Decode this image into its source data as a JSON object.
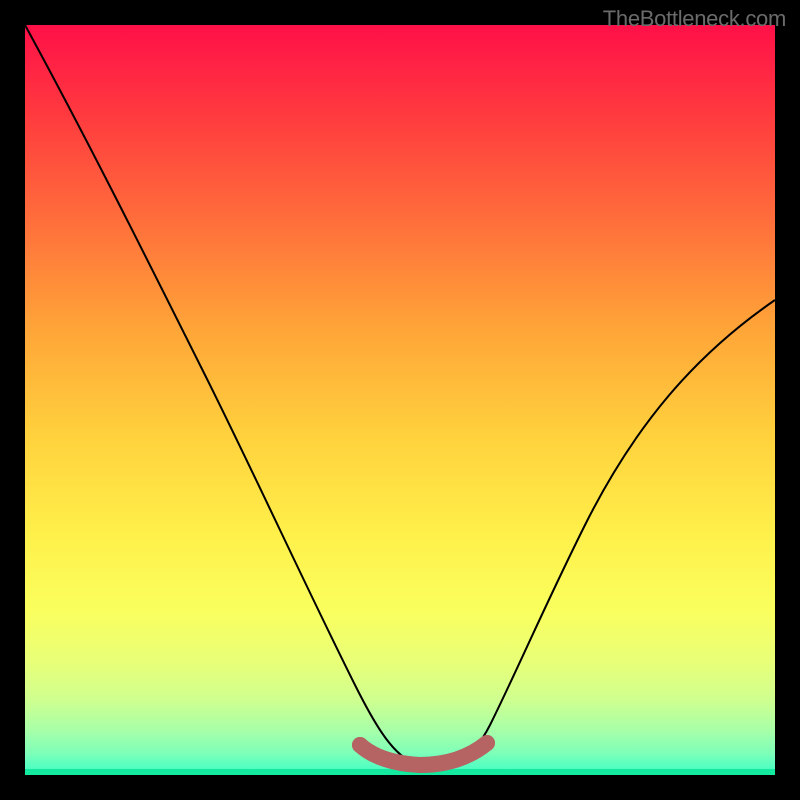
{
  "watermark": "TheBottleneck.com",
  "colors": {
    "frame": "#000000",
    "gradient_top": "#ff1048",
    "gradient_mid": "#ffd23d",
    "gradient_bottom": "#13e99f",
    "curve": "#000000",
    "band": "#b56363"
  },
  "chart_data": {
    "type": "line",
    "title": "",
    "xlabel": "",
    "ylabel": "",
    "xlim": [
      0,
      100
    ],
    "ylim": [
      0,
      100
    ],
    "grid": false,
    "legend": false,
    "annotations": [
      "TheBottleneck.com"
    ],
    "series": [
      {
        "name": "bottleneck-curve",
        "x": [
          0,
          5,
          10,
          15,
          20,
          25,
          30,
          35,
          40,
          42,
          45,
          48,
          51,
          54,
          57,
          60,
          62,
          65,
          70,
          75,
          80,
          85,
          90,
          95,
          100
        ],
        "y": [
          100,
          92,
          83,
          73,
          62,
          51,
          40,
          30,
          20,
          14,
          8,
          4,
          2,
          1,
          1,
          2,
          4,
          8,
          15,
          24,
          33,
          42,
          50,
          57,
          63
        ]
      },
      {
        "name": "zero-bottleneck-band",
        "x": [
          45,
          48,
          51,
          54,
          57,
          60,
          62
        ],
        "y": [
          4,
          2,
          1,
          1,
          1,
          2,
          4
        ]
      }
    ]
  }
}
